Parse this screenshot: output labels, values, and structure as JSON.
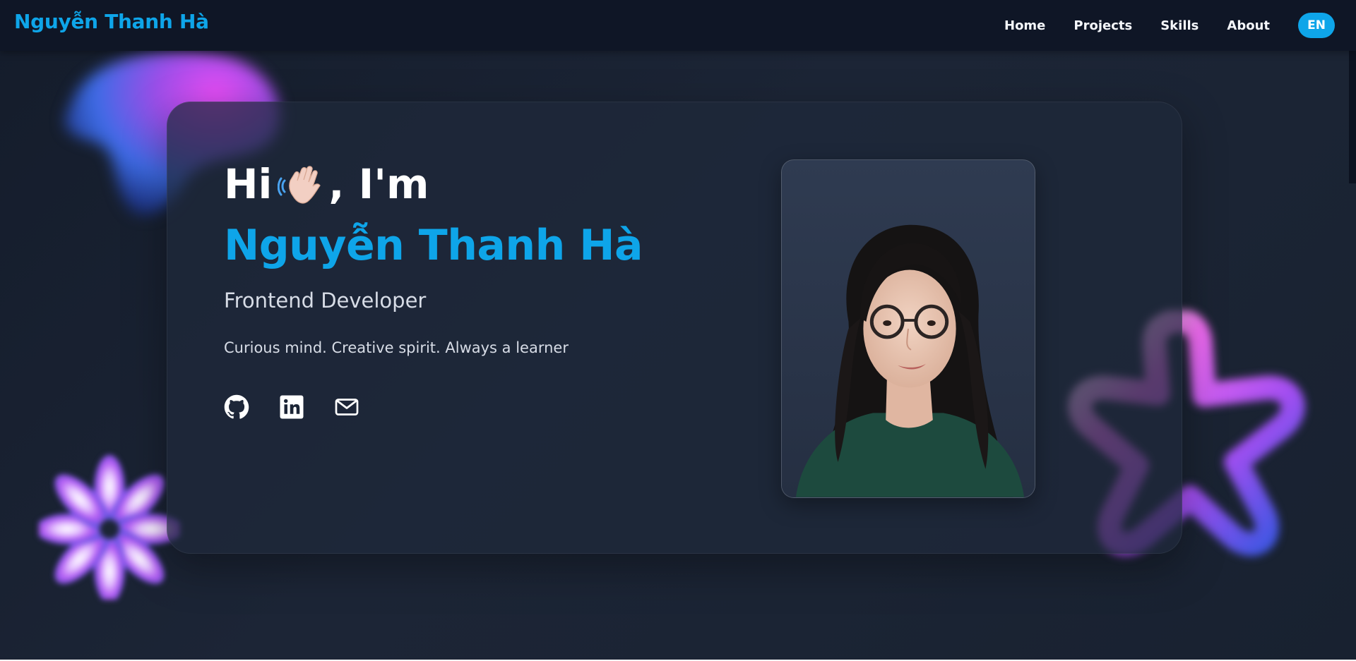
{
  "brand": {
    "name": "Nguyễn Thanh Hà",
    "color": "#0ea5e9"
  },
  "nav": {
    "links": [
      "Home",
      "Projects",
      "Skills",
      "About"
    ],
    "language_button": "EN"
  },
  "hero": {
    "greeting_prefix": "Hi",
    "greeting_suffix": ", I'm",
    "greeting_emoji": "waving-hand-icon",
    "name": "Nguyễn Thanh Hà",
    "role": "Frontend Developer",
    "tagline": "Curious mind. Creative spirit. Always a learner",
    "socials": [
      {
        "icon": "github-icon"
      },
      {
        "icon": "linkedin-icon"
      },
      {
        "icon": "mail-icon"
      }
    ],
    "photo": "profile-photo"
  },
  "colors": {
    "accent": "#0ea5e9",
    "background": "#1b2434",
    "navbar": "#0f1626",
    "text": "#ffffff",
    "muted_text": "#d7dce6"
  }
}
